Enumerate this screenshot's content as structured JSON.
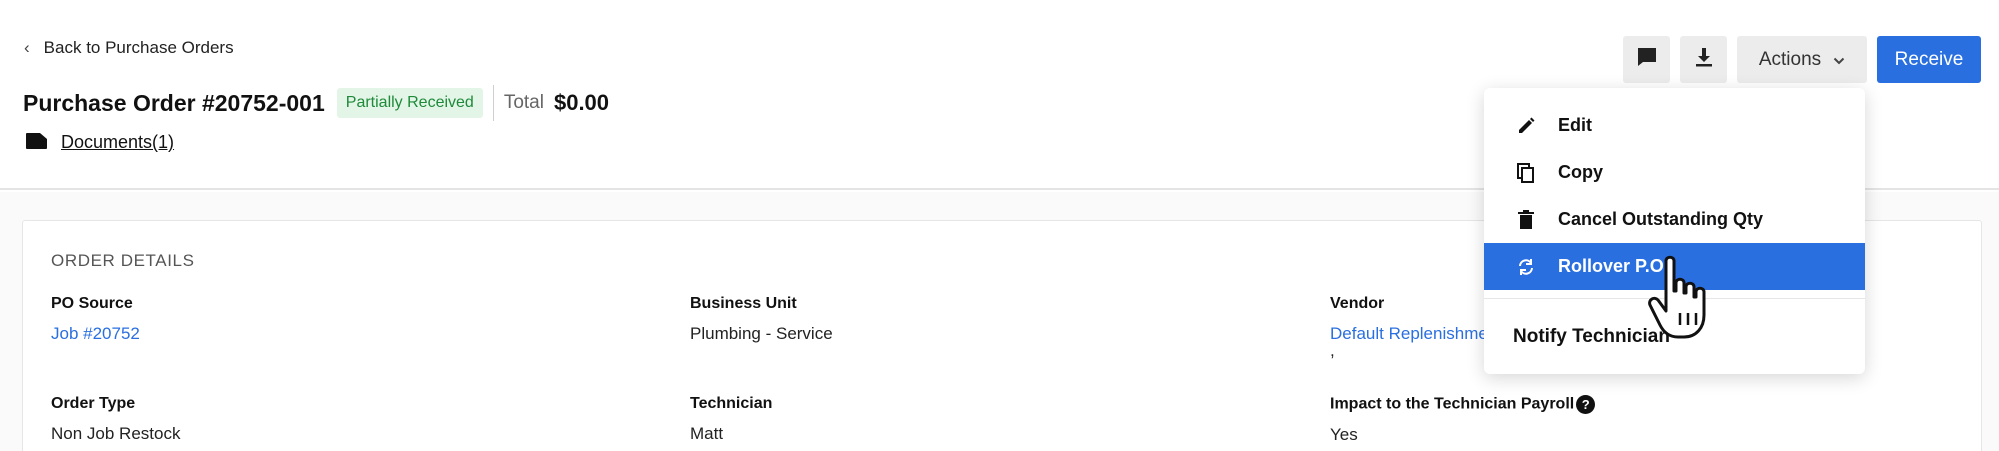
{
  "nav": {
    "back_label": "Back to Purchase Orders"
  },
  "header": {
    "title": "Purchase Order #20752-001",
    "status": "Partially Received",
    "total_label": "Total",
    "total_value": "$0.00",
    "documents_label": "Documents(1)"
  },
  "toolbar": {
    "comment_icon": "comment-icon",
    "download_icon": "download-icon",
    "actions_label": "Actions",
    "receive_label": "Receive"
  },
  "actions_menu": {
    "items": [
      {
        "label": "Edit",
        "icon": "pencil-icon"
      },
      {
        "label": "Copy",
        "icon": "copy-icon"
      },
      {
        "label": "Cancel Outstanding Qty",
        "icon": "trash-icon"
      },
      {
        "label": "Rollover P.O.",
        "icon": "refresh-icon",
        "active": true
      }
    ],
    "notify_label": "Notify Technician"
  },
  "order_details": {
    "section_title": "ORDER DETAILS",
    "po_source": {
      "label": "PO Source",
      "value": "Job #20752"
    },
    "business_unit": {
      "label": "Business Unit",
      "value": "Plumbing - Service"
    },
    "vendor": {
      "label": "Vendor",
      "value": "Default Replenishme",
      "sub": ","
    },
    "order_type": {
      "label": "Order Type",
      "value": "Non Job Restock"
    },
    "technician": {
      "label": "Technician",
      "value": "Matt"
    },
    "payroll_impact": {
      "label": "Impact to the Technician Payroll",
      "value": "Yes"
    }
  },
  "colors": {
    "accent": "#2a6fe0",
    "badge_bg": "#e3f5e7",
    "badge_fg": "#1e8a3a"
  }
}
